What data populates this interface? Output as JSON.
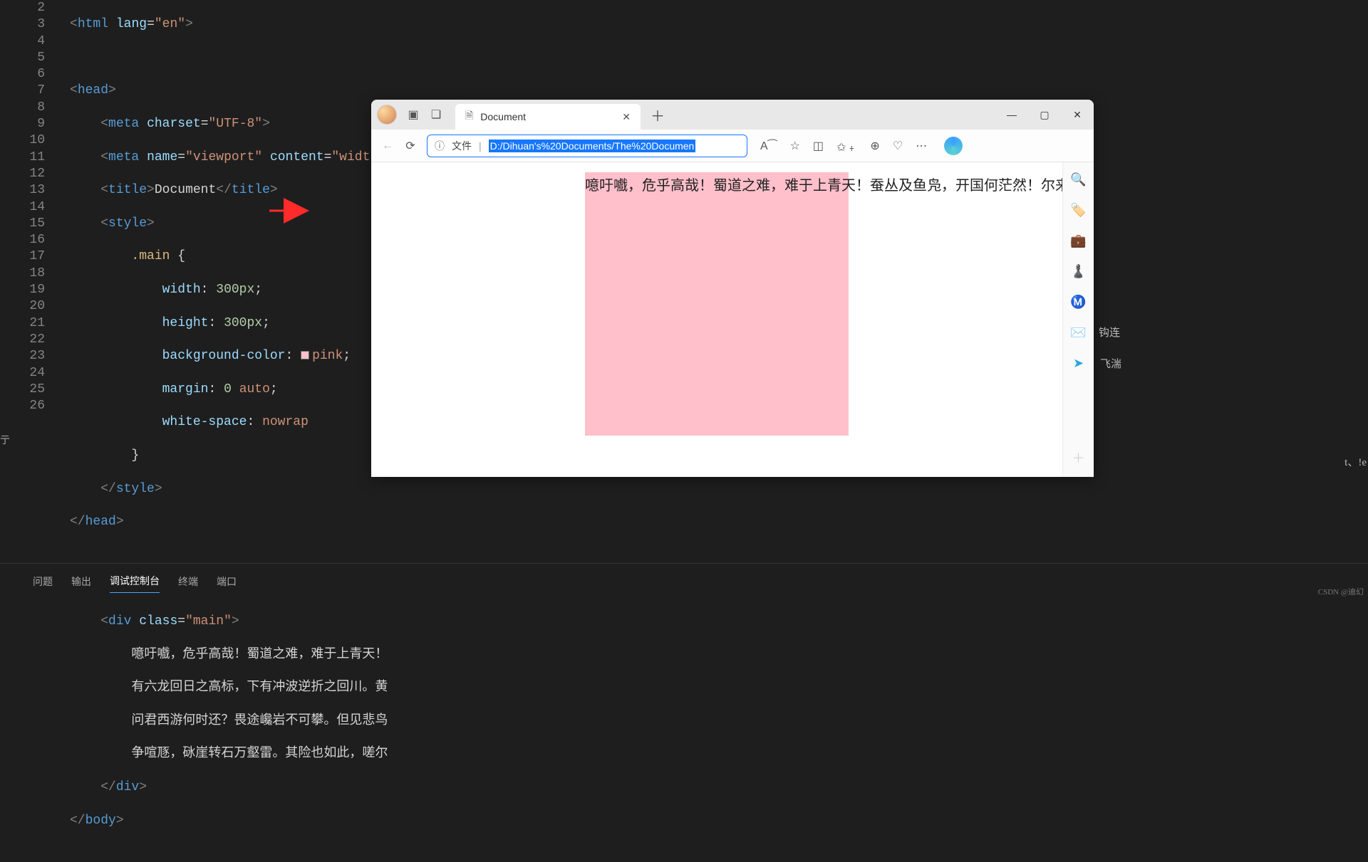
{
  "editor": {
    "lines": [
      2,
      3,
      4,
      5,
      6,
      7,
      8,
      9,
      10,
      11,
      12,
      13,
      14,
      15,
      16,
      17,
      18,
      19,
      20,
      21,
      22,
      23,
      24,
      25,
      26
    ],
    "code_text": {
      "l21": "噫吁嚱，危乎高哉！蜀道之难，难于上青天！",
      "l22a": "有六龙回日之高标，下有冲波逆折之回川。黄",
      "l22b": "问君西游何时还？畏途巉岩不可攀。但见悲鸟",
      "l22c": "争喧豗，砯崖转石万壑雷。其险也如此，嗟尔"
    }
  },
  "panel": {
    "tabs": [
      "问题",
      "输出",
      "调试控制台",
      "终端",
      "端口"
    ],
    "active": 2
  },
  "browser": {
    "tab_title": "Document",
    "addr_file_label": "文件",
    "url_selected": "D:/Dihuan's%20Documents/The%20Documen",
    "readaloud": "A⁀",
    "page_text": "噫吁嚱，危乎高哉！蜀道之难，难于上青天！蚕丛及鱼凫，开国何茫然！尔来"
  },
  "stray": {
    "a": "钩连",
    "b": "飞湍",
    "c": "t、!e"
  },
  "watermark": "CSDN @迪幻",
  "left_edge": "亍"
}
